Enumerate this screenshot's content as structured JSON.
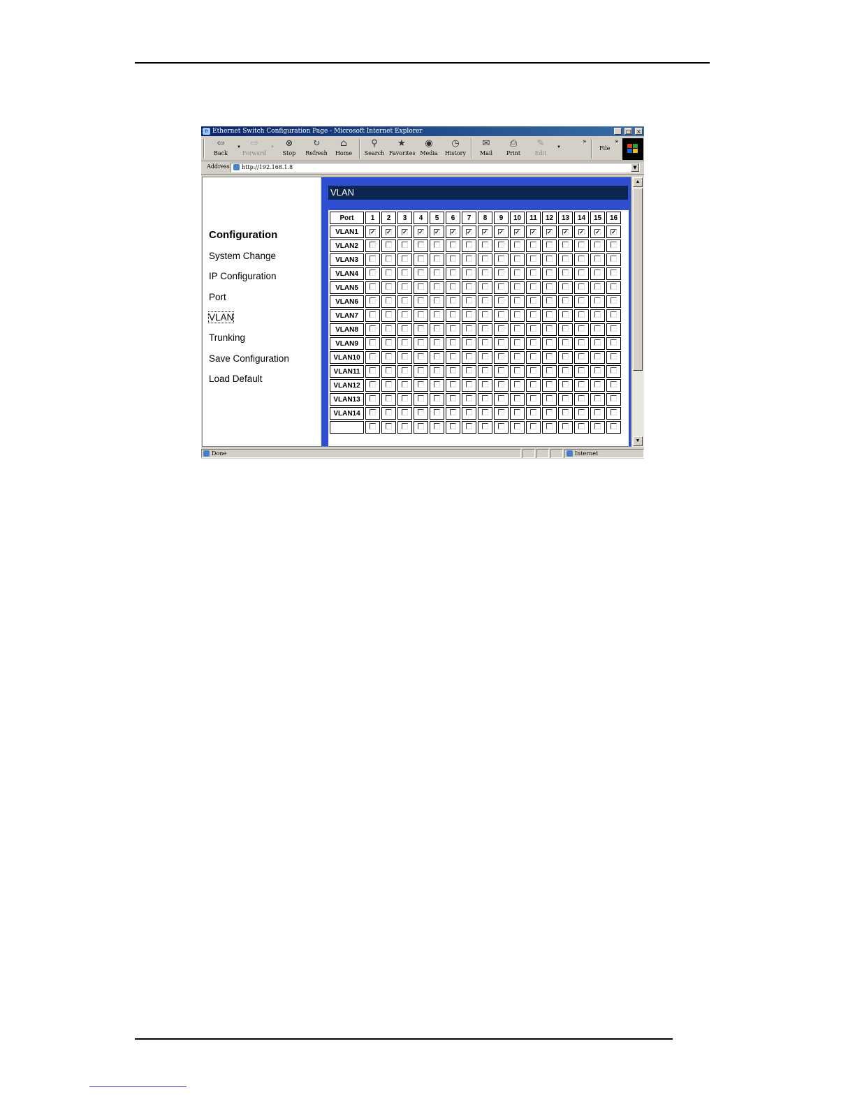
{
  "browser": {
    "title": "Ethernet Switch Configuration Page - Microsoft Internet Explorer",
    "window_buttons": {
      "minimize": "_",
      "maximize": "□",
      "close": "×"
    },
    "toolbar": {
      "back": "Back",
      "forward": "Forward",
      "stop": "Stop",
      "refresh": "Refresh",
      "home": "Home",
      "search": "Search",
      "favorites": "Favorites",
      "media": "Media",
      "history": "History",
      "mail": "Mail",
      "print": "Print",
      "edit": "Edit",
      "chevron": "»",
      "file_menu": "File"
    },
    "address": {
      "label": "Address",
      "url": "http://192.168.1.8"
    },
    "status": {
      "text": "Done",
      "zone": "Internet"
    }
  },
  "nav": {
    "heading": "Configuration",
    "items": [
      "System Change",
      "IP Configuration",
      "Port",
      "VLAN",
      "Trunking",
      "Save Configuration",
      "Load Default"
    ],
    "active": "VLAN"
  },
  "vlan_page": {
    "title": "VLAN",
    "header_label": "Port",
    "ports": [
      "1",
      "2",
      "3",
      "4",
      "5",
      "6",
      "7",
      "8",
      "9",
      "10",
      "11",
      "12",
      "13",
      "14",
      "15",
      "16"
    ],
    "rows": [
      {
        "name": "VLAN1",
        "members": [
          1,
          1,
          1,
          1,
          1,
          1,
          1,
          1,
          1,
          1,
          1,
          1,
          1,
          1,
          1,
          1
        ]
      },
      {
        "name": "VLAN2",
        "members": [
          0,
          0,
          0,
          0,
          0,
          0,
          0,
          0,
          0,
          0,
          0,
          0,
          0,
          0,
          0,
          0
        ]
      },
      {
        "name": "VLAN3",
        "members": [
          0,
          0,
          0,
          0,
          0,
          0,
          0,
          0,
          0,
          0,
          0,
          0,
          0,
          0,
          0,
          0
        ]
      },
      {
        "name": "VLAN4",
        "members": [
          0,
          0,
          0,
          0,
          0,
          0,
          0,
          0,
          0,
          0,
          0,
          0,
          0,
          0,
          0,
          0
        ]
      },
      {
        "name": "VLAN5",
        "members": [
          0,
          0,
          0,
          0,
          0,
          0,
          0,
          0,
          0,
          0,
          0,
          0,
          0,
          0,
          0,
          0
        ]
      },
      {
        "name": "VLAN6",
        "members": [
          0,
          0,
          0,
          0,
          0,
          0,
          0,
          0,
          0,
          0,
          0,
          0,
          0,
          0,
          0,
          0
        ]
      },
      {
        "name": "VLAN7",
        "members": [
          0,
          0,
          0,
          0,
          0,
          0,
          0,
          0,
          0,
          0,
          0,
          0,
          0,
          0,
          0,
          0
        ]
      },
      {
        "name": "VLAN8",
        "members": [
          0,
          0,
          0,
          0,
          0,
          0,
          0,
          0,
          0,
          0,
          0,
          0,
          0,
          0,
          0,
          0
        ]
      },
      {
        "name": "VLAN9",
        "members": [
          0,
          0,
          0,
          0,
          0,
          0,
          0,
          0,
          0,
          0,
          0,
          0,
          0,
          0,
          0,
          0
        ]
      },
      {
        "name": "VLAN10",
        "members": [
          0,
          0,
          0,
          0,
          0,
          0,
          0,
          0,
          0,
          0,
          0,
          0,
          0,
          0,
          0,
          0
        ]
      },
      {
        "name": "VLAN11",
        "members": [
          0,
          0,
          0,
          0,
          0,
          0,
          0,
          0,
          0,
          0,
          0,
          0,
          0,
          0,
          0,
          0
        ]
      },
      {
        "name": "VLAN12",
        "members": [
          0,
          0,
          0,
          0,
          0,
          0,
          0,
          0,
          0,
          0,
          0,
          0,
          0,
          0,
          0,
          0
        ]
      },
      {
        "name": "VLAN13",
        "members": [
          0,
          0,
          0,
          0,
          0,
          0,
          0,
          0,
          0,
          0,
          0,
          0,
          0,
          0,
          0,
          0
        ]
      },
      {
        "name": "VLAN14",
        "members": [
          0,
          0,
          0,
          0,
          0,
          0,
          0,
          0,
          0,
          0,
          0,
          0,
          0,
          0,
          0,
          0
        ]
      },
      {
        "name": "",
        "members": [
          0,
          0,
          0,
          0,
          0,
          0,
          0,
          0,
          0,
          0,
          0,
          0,
          0,
          0,
          0,
          0
        ]
      }
    ]
  },
  "colors": {
    "title_bar": "#0a246a",
    "vlan_frame": "#2f4fd0",
    "vlan_title_bar": "#0b2650"
  }
}
